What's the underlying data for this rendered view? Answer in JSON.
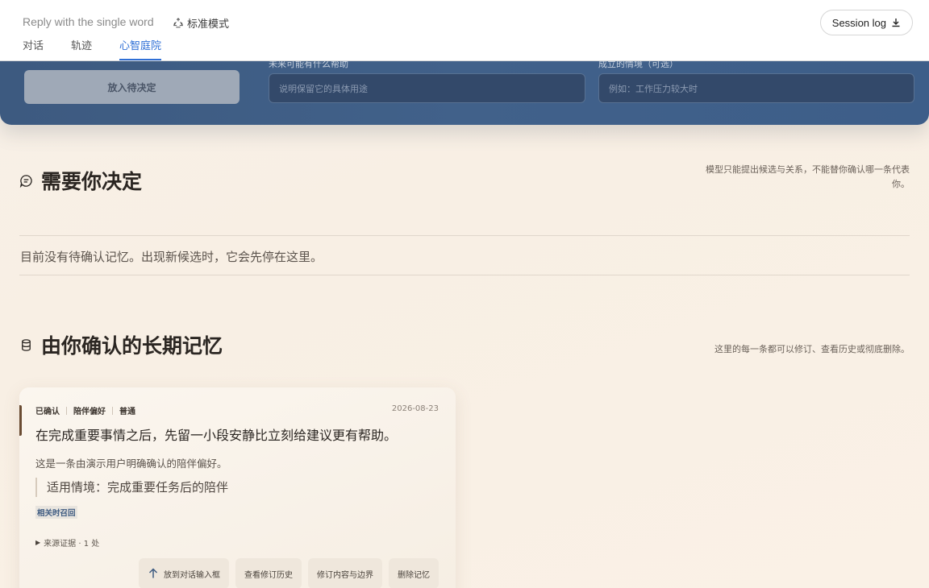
{
  "header": {
    "conversation_title": "Reply with the single word",
    "mode_label": "标准模式",
    "session_log_label": "Session log",
    "tabs": [
      {
        "label": "对话",
        "active": false
      },
      {
        "label": "轨迹",
        "active": false
      },
      {
        "label": "心智庭院",
        "active": true
      }
    ]
  },
  "composer": {
    "pending_button_label": "放入待决定",
    "usage_label": "未来可能有什么帮助",
    "usage_placeholder": "说明保留它的具体用途",
    "context_label": "成立的情境（可选）",
    "context_placeholder": "例如：工作压力较大时"
  },
  "decide_section": {
    "title": "需要你决定",
    "note": "模型只能提出候选与关系，不能替你确认哪一条代表你。",
    "empty_text": "目前没有待确认记忆。出现新候选时，它会先停在这里。"
  },
  "memory_section": {
    "title": "由你确认的长期记忆",
    "note": "这里的每一条都可以修订、查看历史或彻底删除。",
    "cards": [
      {
        "tags": [
          "已确认",
          "陪伴偏好",
          "普通"
        ],
        "date": "2026-08-23",
        "title": "在完成重要事情之后，先留一小段安静比立刻给建议更有帮助。",
        "description": "这是一条由演示用户明确确认的陪伴偏好。",
        "context": "适用情境：完成重要任务后的陪伴",
        "recall_tag": "相关时召回",
        "evidence": "来源证据 · 1 处",
        "actions": {
          "send_to_input": "放到对话输入框",
          "view_history": "查看修订历史",
          "revise": "修订内容与边界",
          "delete": "删除记忆"
        }
      }
    ]
  },
  "colors": {
    "accent_blue": "#2f6fd6",
    "panel_blue": "#3d5a80",
    "background": "#f8efe4"
  },
  "icons": {
    "mode": "recycle-icon",
    "session_log": "download-icon",
    "decide_section": "chat-bubble-icon",
    "memory_section": "database-icon",
    "send_to_input": "arrow-up-icon"
  }
}
